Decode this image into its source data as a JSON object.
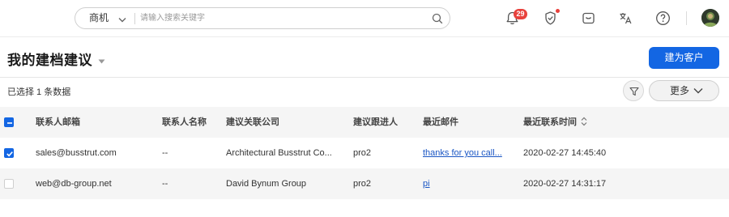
{
  "search": {
    "scope": "商机",
    "placeholder": "请输入搜索关键字"
  },
  "topbar": {
    "notification_count": "29",
    "icons": [
      "bell-icon",
      "shield-icon",
      "calendar-box-icon",
      "translate-icon",
      "help-icon",
      "avatar"
    ]
  },
  "page": {
    "title": "我的建档建议",
    "create_button": "建为客户",
    "selection_text": "已选择 1 条数据",
    "more_button": "更多"
  },
  "table": {
    "columns": [
      "联系人邮箱",
      "联系人名称",
      "建议关联公司",
      "建议跟进人",
      "最近邮件",
      "最近联系时间"
    ],
    "header_checkbox": "indeterminate",
    "rows": [
      {
        "checked": true,
        "email": "sales@busstrut.com",
        "name": "--",
        "company": "Architectural Busstrut Co...",
        "owner": "pro2",
        "recent_mail": "thanks for you call...",
        "last_contact": "2020-02-27 14:45:40"
      },
      {
        "checked": false,
        "email": "web@db-group.net",
        "name": "--",
        "company": "David Bynum Group",
        "owner": "pro2",
        "recent_mail": "pi",
        "last_contact": "2020-02-27 14:31:17"
      }
    ]
  },
  "colors": {
    "primary": "#1366e3",
    "badge": "#e8413c",
    "link": "#1a56c4",
    "row_alt": "#f5f5f5"
  }
}
